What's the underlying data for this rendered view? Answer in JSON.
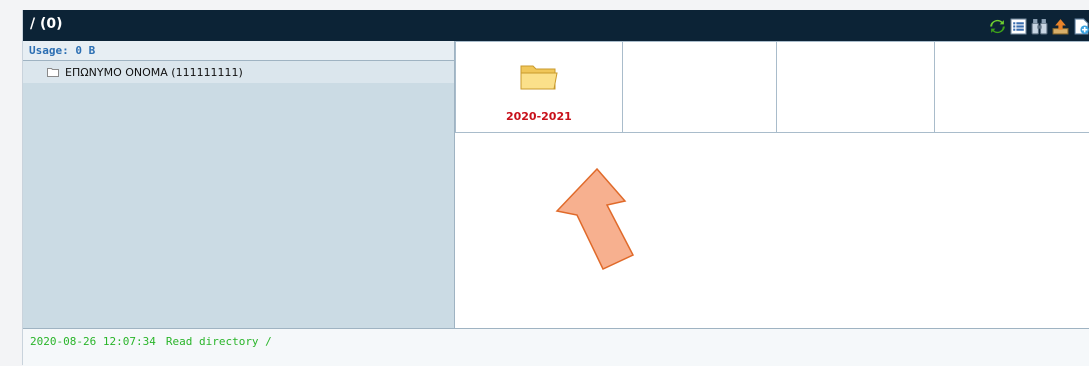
{
  "header": {
    "title": "/ (0)",
    "toolbar": [
      {
        "icon": "refresh-icon"
      },
      {
        "icon": "list-view-icon"
      },
      {
        "icon": "binoculars-icon"
      },
      {
        "icon": "upload-icon"
      },
      {
        "icon": "new-file-icon"
      }
    ]
  },
  "sidebar": {
    "usage": "Usage: 0 B",
    "tree": [
      {
        "label": "ΕΠΩΝΥΜΟ ΟΝΟΜΑ (111111111)",
        "icon": "folder-icon"
      }
    ]
  },
  "files": [
    {
      "name": "2020-2021",
      "icon": "folder-icon"
    }
  ],
  "status": {
    "timestamp": "2020-08-26 12:07:34",
    "message": "Read directory /"
  },
  "colors": {
    "titlebar": "#0c2336",
    "sidebar": "#cbdbe4",
    "folder_label": "#c8111b",
    "status_text": "#2ab52a",
    "usage_text": "#2c6fb3"
  }
}
